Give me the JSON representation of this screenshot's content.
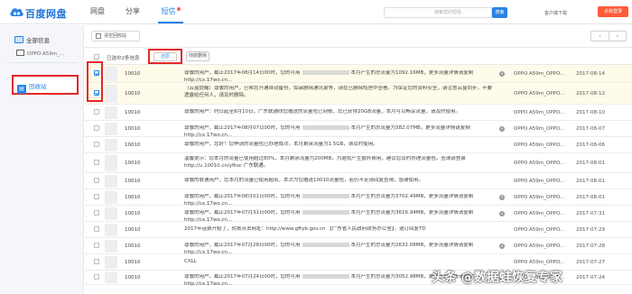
{
  "brand": "百度网盘",
  "nav": [
    {
      "label": "网盘"
    },
    {
      "label": "分享"
    },
    {
      "label": "短信"
    }
  ],
  "search": {
    "placeholder": "搜索您的短信",
    "button": "搜索"
  },
  "header": {
    "client_download": "客户端下载",
    "login_label": "点我登录"
  },
  "sidebar": {
    "all_label": "全部信息",
    "device_label": "OPPO A59m_...",
    "recycle_label": "回收站"
  },
  "toolbar": {
    "clear_label": "清空回收站",
    "prev": "‹",
    "next": "›"
  },
  "actions": {
    "selected_text": "已选中2条信息",
    "restore_label": "还原",
    "delete_label": "彻底删除"
  },
  "rows": [
    {
      "checked": true,
      "sender": "10010",
      "text": "尊敬的用户，截止2017年08月14日00时，您的可用",
      "tail": "本月产生的总流量为1092.16MB，更多流量详情请复制http://cx.17wo.cn...",
      "device": "OPPO A59m_OPPO...",
      "date": "2017-08-14"
    },
    {
      "checked": true,
      "sender": "10010",
      "text": "（云盒提醒）尊敬的用户，已帮您开通自动备份，如需删除通讯录等，请在已删除短信中查看。为保证您的资料安全，请注意云盒同步，不要透露给任何人，请及时删除。",
      "tail": "",
      "device": "OPPO A59m_OPPO...",
      "date": "2017-08-12"
    },
    {
      "checked": false,
      "sender": "10010",
      "text": "尊敬的用户：时日起至8月10日，广东联通向您赠送的流量包已到账，您已获得20GB流量，本月可以畅享流量，请及时使用。",
      "tail": "",
      "device": "OPPO A59m_OPPO...",
      "date": "2017-08-10"
    },
    {
      "checked": false,
      "sender": "10010",
      "text": "尊敬的用户，截止2017年08月07日00时，您的可用",
      "tail": "本月产生的总流量为382.07MB，更多流量详情请复制http://cx.17wo.cn...",
      "device": "OPPO A59m_OPPO...",
      "date": "2017-08-07"
    },
    {
      "checked": false,
      "sender": "10010",
      "text": "尊敬的用户，您好！您申请的流量包已办理成功，本月剩余流量为1.5GB，请及时使用。",
      "tail": "",
      "device": "OPPO A59m_OPPO...",
      "date": "2017-08-06"
    },
    {
      "checked": false,
      "sender": "10010",
      "text": "温馨提示：您本月的流量已使用超过80%，本月剩余流量为200MB，为避免产生额外费用，建议您及时办理流量包。查询请登录http://u.10010.cn/yfksc 广东联通。",
      "tail": "",
      "device": "OPPO A59m_OPPO...",
      "date": "2017-08-01"
    },
    {
      "checked": false,
      "sender": "10010",
      "text": "尊敬的联通用户，您本月的流量已使用超出，本次为您赠送10010流量包，若仍不足请回复查询，感谢使用。",
      "tail": "",
      "device": "OPPO A59m_OPPO...",
      "date": "2017-08-01"
    },
    {
      "checked": false,
      "sender": "10010",
      "text": "尊敬的用户，截止2017年08月01日00时，您的可用",
      "tail": "本月产生的总流量为3702.49MB，更多流量详情请复制http://cx.17wo.cn...",
      "device": "OPPO A59m_OPPO...",
      "date": "2017-08-01"
    },
    {
      "checked": false,
      "sender": "10010",
      "text": "尊敬的用户，截止2017年07月31日00时，您的可用",
      "tail": "本月产生的总流量为3616.94MB，更多流量详情请复制http://cx.17wo.cn...",
      "device": "OPPO A59m_OPPO...",
      "date": "2017-07-31"
    },
    {
      "checked": false,
      "sender": "10010",
      "text": "2017年话费开始了，转账点击网址：http://www.gftyb.gov.cn 【广东省人民政府政务办公室】。退订回复TD",
      "tail": "",
      "device": "OPPO A59m_OPPO...",
      "date": "2017-07-29"
    },
    {
      "checked": false,
      "sender": "10010",
      "text": "尊敬的用户，截止2017年07月28日00时，您的可用",
      "tail": "本月产生的总流量为2632.08MB，更多流量详情请复制http://cx.17wo.cn...",
      "device": "OPPO A59m_OPPO...",
      "date": "2017-07-28"
    },
    {
      "checked": false,
      "sender": "10010",
      "text": "CXLL",
      "tail": "",
      "device": "OPPO A59m_OPPO...",
      "date": "2017-07-27"
    },
    {
      "checked": false,
      "sender": "10010",
      "text": "尊敬的用户，截止2017年07月24日00时，您的可用",
      "tail": "本月产生的总流量为3052.98MB，更多流量详情请复制http://cx.17wo.cn...",
      "device": "OPPO A59m_OPPO...",
      "date": "2017-07-24"
    }
  ],
  "watermark": "头条 @数据蛙恢复专家"
}
